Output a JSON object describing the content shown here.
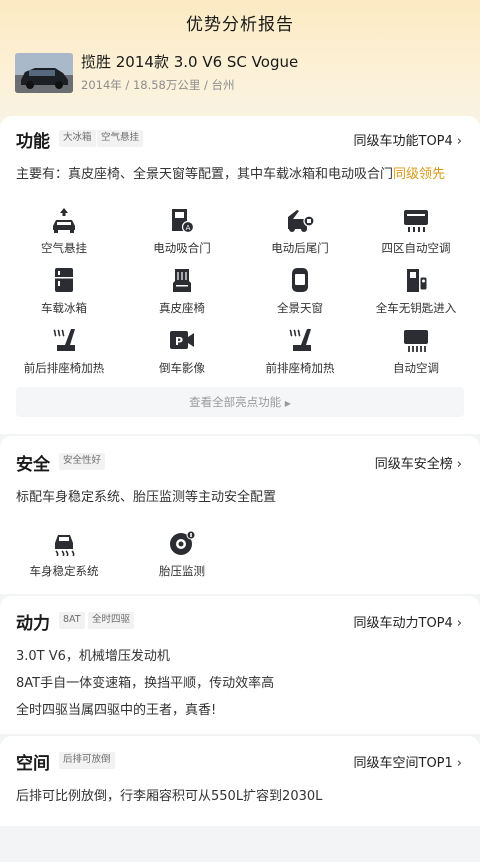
{
  "header": {
    "title": "优势分析报告",
    "car_name": "揽胜 2014款 3.0 V6 SC Vogue",
    "car_meta": "2014年 / 18.58万公里 / 台州"
  },
  "features_section": {
    "title": "功能",
    "tags": [
      "大冰箱",
      "空气悬挂"
    ],
    "rank_label": "同级车功能TOP4",
    "desc_prefix": "主要有：真皮座椅、全景天窗等配置，其中车载冰箱和电动吸合门",
    "desc_highlight": "同级领先",
    "items": [
      {
        "label": "空气悬挂",
        "icon": "air-suspension-icon"
      },
      {
        "label": "电动吸合门",
        "icon": "soft-close-door-icon"
      },
      {
        "label": "电动后尾门",
        "icon": "power-tailgate-icon"
      },
      {
        "label": "四区自动空调",
        "icon": "four-zone-ac-icon"
      },
      {
        "label": "车载冰箱",
        "icon": "car-fridge-icon"
      },
      {
        "label": "真皮座椅",
        "icon": "leather-seat-icon"
      },
      {
        "label": "全景天窗",
        "icon": "panoramic-sunroof-icon"
      },
      {
        "label": "全车无钥匙进入",
        "icon": "keyless-entry-icon"
      },
      {
        "label": "前后排座椅加热",
        "icon": "seat-heating-icon"
      },
      {
        "label": "倒车影像",
        "icon": "reverse-camera-icon"
      },
      {
        "label": "前排座椅加热",
        "icon": "front-seat-heating-icon"
      },
      {
        "label": "自动空调",
        "icon": "auto-ac-icon"
      }
    ],
    "view_all_label": "查看全部亮点功能"
  },
  "safety_section": {
    "title": "安全",
    "tag": "安全性好",
    "rank_label": "同级车安全榜",
    "desc": "标配车身稳定系统、胎压监测等主动安全配置",
    "items": [
      {
        "label": "车身稳定系统",
        "icon": "stability-control-icon"
      },
      {
        "label": "胎压监测",
        "icon": "tire-pressure-icon"
      }
    ]
  },
  "power_section": {
    "title": "动力",
    "tags": [
      "8AT",
      "全时四驱"
    ],
    "rank_label": "同级车动力TOP4",
    "lines": [
      "3.0T V6，机械增压发动机",
      "8AT手自一体变速箱，换挡平顺，传动效率高",
      "全时四驱当属四驱中的王者，真香!"
    ]
  },
  "space_section": {
    "title": "空间",
    "tag": "后排可放倒",
    "rank_label": "同级车空间TOP1",
    "desc": "后排可比例放倒，行李厢容积可从550L扩容到2030L"
  },
  "colors": {
    "accent": "#d99a1a",
    "hero_top": "#fbeac2",
    "icon_dark": "#2b2d33"
  }
}
